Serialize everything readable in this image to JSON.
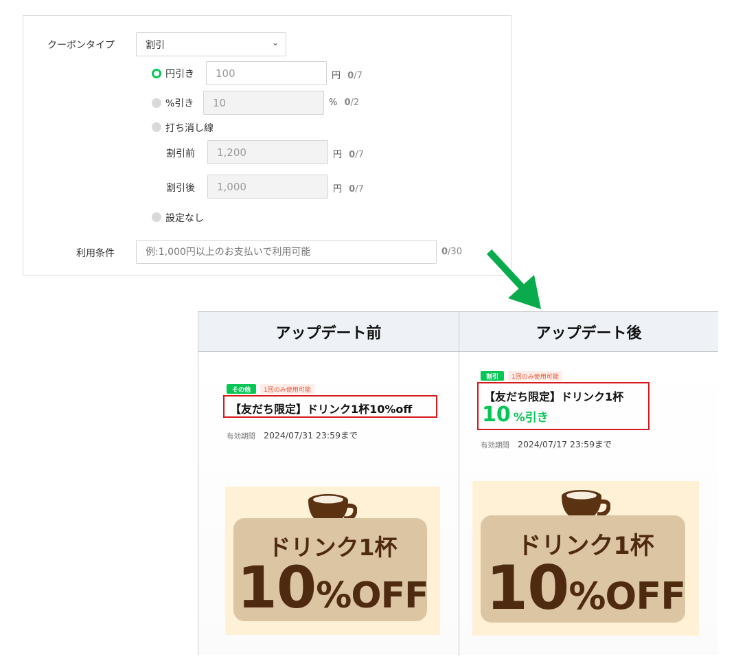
{
  "form": {
    "coupon_type_label": "クーポンタイプ",
    "coupon_type_value": "割引",
    "options": {
      "yen": {
        "label": "円引き",
        "value": "100",
        "unit": "円",
        "count": "0",
        "max": "/7",
        "selected": true
      },
      "percent": {
        "label": "%引き",
        "value": "10",
        "unit": "%",
        "count": "0",
        "max": "/2",
        "selected": false
      },
      "strike": {
        "label": "打ち消し線",
        "selected": false
      },
      "before": {
        "label": "割引前",
        "value": "1,200",
        "unit": "円",
        "count": "0",
        "max": "/7"
      },
      "after": {
        "label": "割引後",
        "value": "1,000",
        "unit": "円",
        "count": "0",
        "max": "/7"
      },
      "none": {
        "label": "設定なし",
        "selected": false
      }
    },
    "condition_label": "利用条件",
    "condition_placeholder": "例:1,000円以上のお支払いで利用可能",
    "condition_count": "0",
    "condition_max": "/30"
  },
  "compare": {
    "before": {
      "header": "アップデート前",
      "badge": "その他",
      "usage": "1回のみ使用可能",
      "title": "【友だち限定】ドリンク1杯10%off",
      "valid_label": "有効期間",
      "valid_value": "2024/07/31 23:59まで",
      "image_line1": "ドリンク1杯",
      "image_num": "10",
      "image_suffix": "%OFF"
    },
    "after": {
      "header": "アップデート後",
      "badge": "割引",
      "usage": "1回のみ使用可能",
      "title": "【友だち限定】ドリンク1杯",
      "discount_num": "10",
      "discount_suffix": "%引き",
      "valid_label": "有効期間",
      "valid_value": "2024/07/17 23:59まで",
      "image_line1": "ドリンク1杯",
      "image_num": "10",
      "image_suffix": "%OFF"
    }
  },
  "colors": {
    "accent": "#06c755",
    "highlight_border": "#d6171c",
    "arrow": "#0aab4c",
    "header_bg": "#eef1f6",
    "image_bg": "#fff1d6",
    "coffee": "#5b3212"
  },
  "icons": {
    "dropdown": "chevron-down-icon",
    "arrow": "arrow-down-right-icon",
    "cup": "coffee-cup-icon"
  }
}
